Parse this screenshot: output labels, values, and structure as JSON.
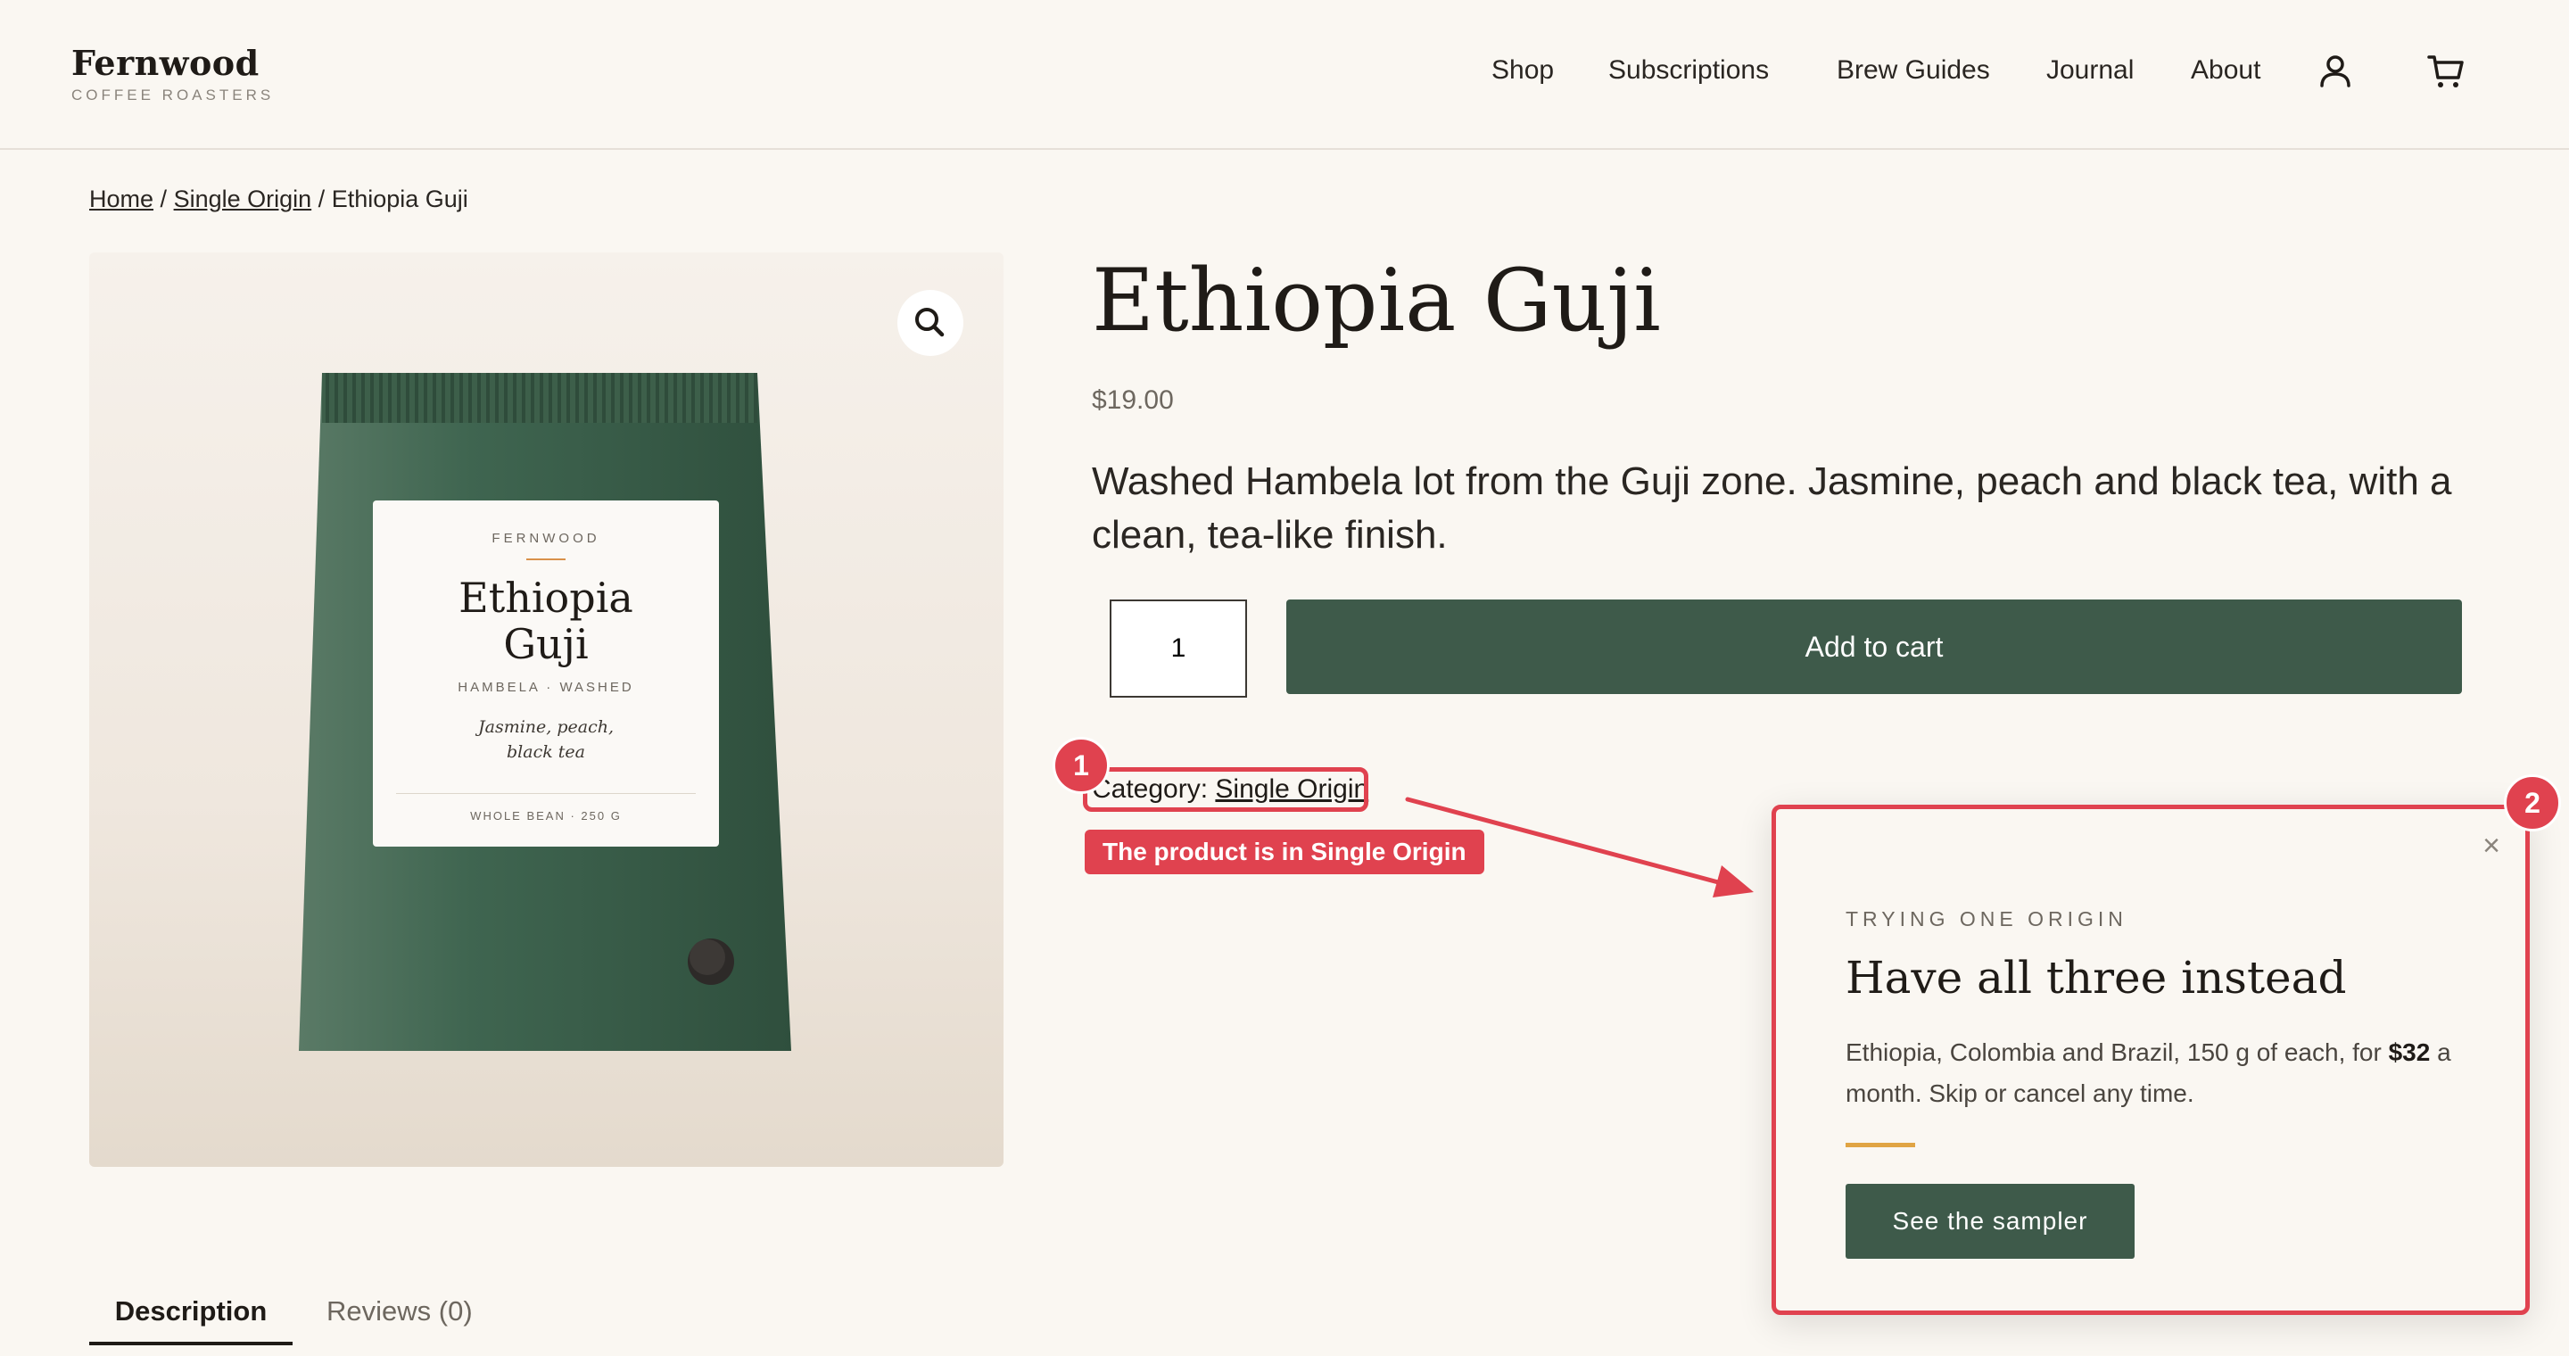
{
  "header": {
    "logo_name": "Fernwood",
    "logo_sub": "COFFEE ROASTERS",
    "nav": [
      "Shop",
      "Subscriptions",
      "Brew Guides",
      "Journal",
      "About"
    ],
    "account_icon": "user-icon",
    "cart_icon": "cart-icon"
  },
  "breadcrumb": {
    "home": "Home",
    "sep": "/",
    "category": "Single Origin",
    "current": "Ethiopia Guji"
  },
  "gallery": {
    "zoom_icon": "magnifier-icon",
    "label": {
      "brand": "FERNWOOD",
      "title_line1": "Ethiopia",
      "title_line2": "Guji",
      "subtitle": "HAMBELA · WASHED",
      "notes_line1": "Jasmine, peach,",
      "notes_line2": "black tea",
      "footer": "WHOLE BEAN · 250 G"
    }
  },
  "product": {
    "title": "Ethiopia Guji",
    "price": "$19.00",
    "description": "Washed Hambela lot from the Guji zone. Jasmine, peach and black tea, with a clean, tea-like finish.",
    "quantity": "1",
    "add_to_cart": "Add to cart",
    "category_label": "Category:",
    "category_value": "Single Origin"
  },
  "annotations": {
    "badge1": "1",
    "badge2": "2",
    "note1": "The product is in Single Origin",
    "color": "#e0424f"
  },
  "tabs": {
    "description": "Description",
    "reviews": "Reviews (0)"
  },
  "popup": {
    "close": "×",
    "eyebrow": "TRYING ONE ORIGIN",
    "title": "Have all three instead",
    "text_before": "Ethiopia, Colombia and Brazil, 150 g of each, for",
    "price": "$32",
    "text_after": "a month. Skip or cancel any time.",
    "button": "See the sampler"
  },
  "colors": {
    "background": "#faf7f2",
    "brand_green": "#3e5a4a",
    "accent_gold": "#e0a444",
    "annotation_red": "#e0424f"
  }
}
